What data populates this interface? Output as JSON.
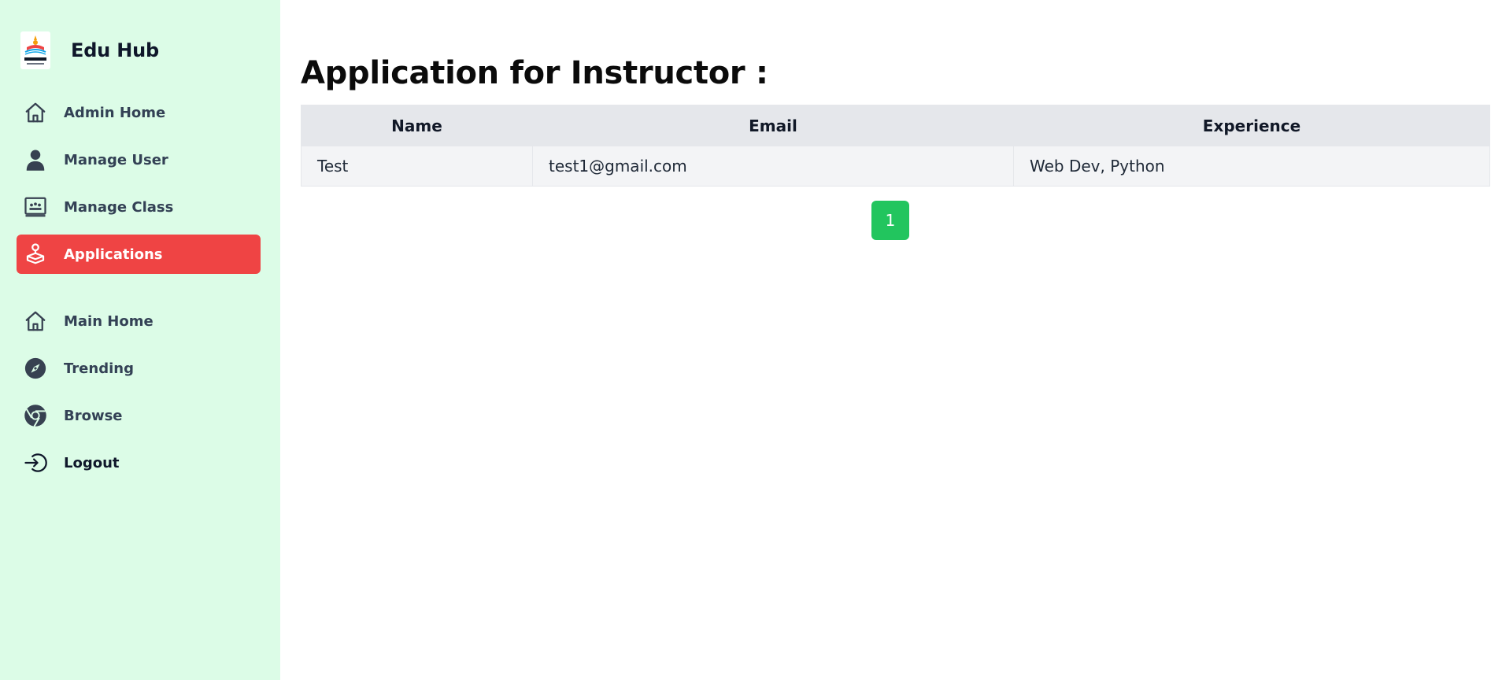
{
  "brand": {
    "name": "Edu Hub"
  },
  "sidebar": {
    "items": [
      {
        "label": "Admin Home",
        "icon": "home-icon"
      },
      {
        "label": "Manage User",
        "icon": "user-icon"
      },
      {
        "label": "Manage Class",
        "icon": "classroom-icon"
      },
      {
        "label": "Applications",
        "icon": "applications-icon",
        "active": true
      }
    ],
    "secondary_items": [
      {
        "label": "Main Home",
        "icon": "home-icon"
      },
      {
        "label": "Trending",
        "icon": "compass-icon"
      },
      {
        "label": "Browse",
        "icon": "chrome-icon"
      },
      {
        "label": "Logout",
        "icon": "logout-icon"
      }
    ]
  },
  "main": {
    "title": "Application for Instructor :",
    "table": {
      "columns": [
        "Name",
        "Email",
        "Experience"
      ],
      "rows": [
        [
          "Test",
          "test1@gmail.com",
          "Web Dev, Python"
        ]
      ]
    },
    "pagination": {
      "pages": [
        "1"
      ],
      "current": "1"
    }
  },
  "colors": {
    "sidebar_bg": "#dcfce7",
    "active_item": "#ef4444",
    "pager_active": "#22c55e",
    "table_header_bg": "#e5e7eb",
    "table_row_bg": "#f3f4f6"
  }
}
